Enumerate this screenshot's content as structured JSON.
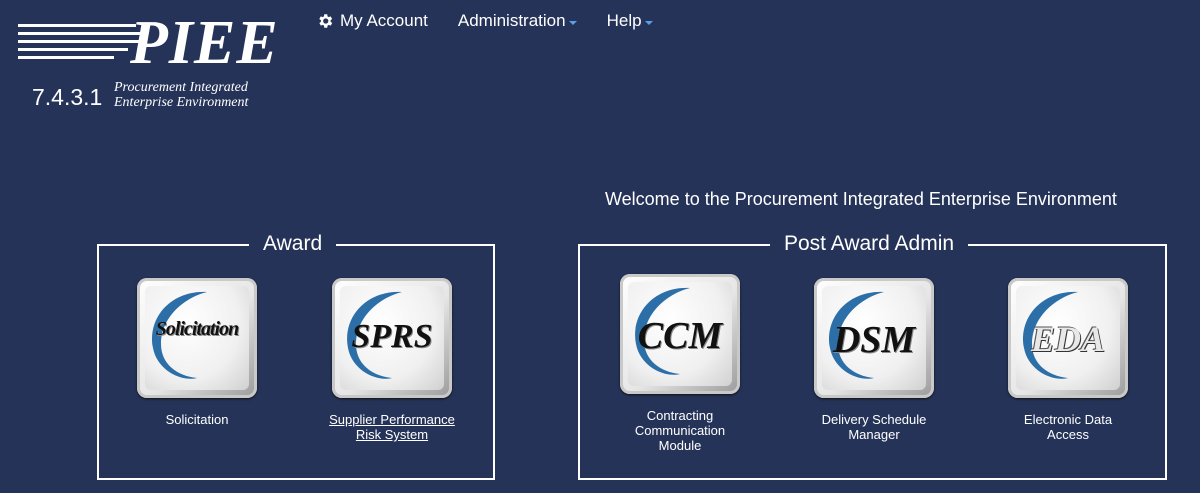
{
  "logo": {
    "word": "PIEE",
    "version": "7.4.3.1",
    "tagline_line1": "Procurement Integrated",
    "tagline_line2": "Enterprise Environment"
  },
  "nav": {
    "my_account": "My Account",
    "administration": "Administration",
    "help": "Help"
  },
  "welcome": "Welcome to the Procurement Integrated Enterprise Environment",
  "groups": {
    "award": {
      "title": "Award",
      "tiles": [
        {
          "key_text": "Solicitation",
          "caption": "Solicitation"
        },
        {
          "key_text": "SPRS",
          "caption": "Supplier Performance Risk System"
        }
      ]
    },
    "post_award": {
      "title": "Post Award Admin",
      "tiles": [
        {
          "key_text": "CCM",
          "caption": "Contracting Communication Module"
        },
        {
          "key_text": "DSM",
          "caption": "Delivery Schedule Manager"
        },
        {
          "key_text": "EDA",
          "caption": "Electronic Data Access"
        }
      ]
    }
  },
  "colors": {
    "background": "#253358",
    "caret": "#5aa0e6",
    "swoosh": "#2c6fa8"
  }
}
